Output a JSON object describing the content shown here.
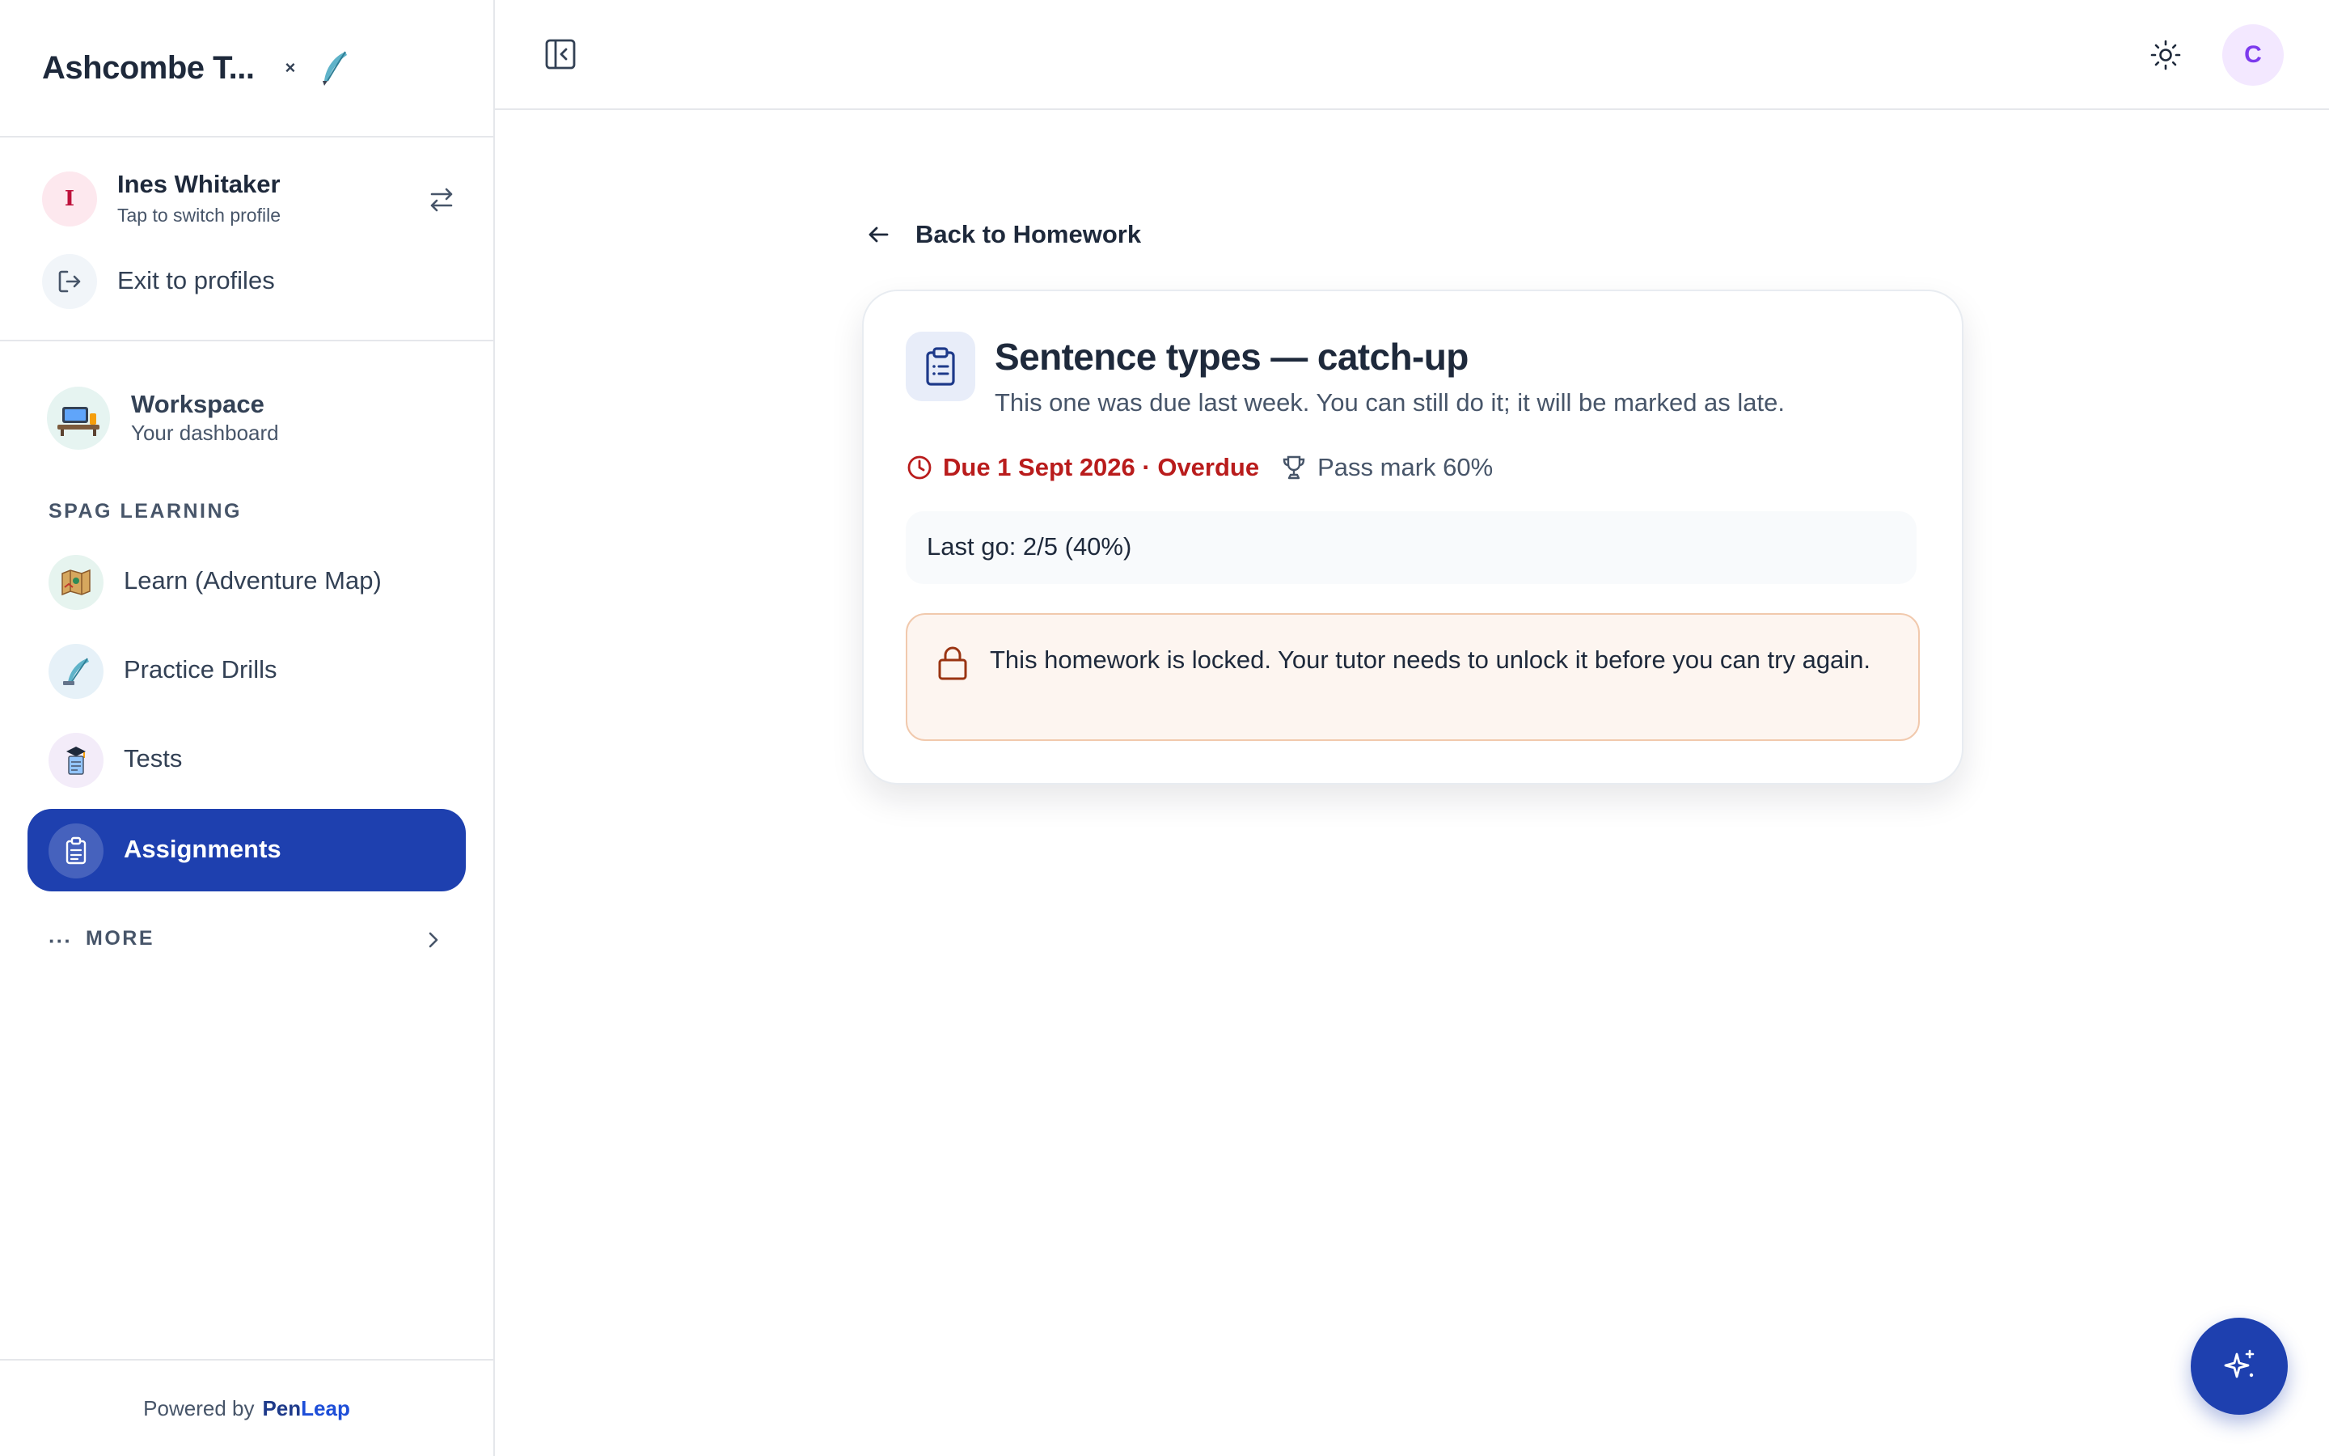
{
  "sidebar": {
    "brand_name": "Ashcombe T...",
    "brand_close": "×",
    "profile": {
      "initial": "I",
      "name": "Ines Whitaker",
      "subtitle": "Tap to switch profile"
    },
    "exit_label": "Exit to profiles",
    "workspace": {
      "title": "Workspace",
      "subtitle": "Your dashboard"
    },
    "section_label": "SPAG LEARNING",
    "nav_items": [
      {
        "label": "Learn (Adventure Map)",
        "icon": "map-icon"
      },
      {
        "label": "Practice Drills",
        "icon": "quill-icon"
      },
      {
        "label": "Tests",
        "icon": "test-icon"
      },
      {
        "label": "Assignments",
        "icon": "clipboard-icon",
        "active": true
      }
    ],
    "more_label": "MORE",
    "powered_by": "Powered by",
    "powered_brand_a": "Pen",
    "powered_brand_b": "Leap"
  },
  "topbar": {
    "user_initial": "C"
  },
  "main": {
    "back_label": "Back to Homework",
    "card": {
      "title": "Sentence types — catch-up",
      "description": "This one was due last week. You can still do it; it will be marked as late.",
      "due": "Due 1 Sept 2026 · Overdue",
      "pass_mark": "Pass mark 60%",
      "last_go": "Last go: 2/5 (40%)",
      "locked_message": "This homework is locked. Your tutor needs to unlock it before you can try again."
    }
  },
  "colors": {
    "primary": "#1e40af",
    "overdue": "#b91c1c",
    "locked_bg": "#fdf5f0",
    "locked_border": "#f1c9ad"
  }
}
